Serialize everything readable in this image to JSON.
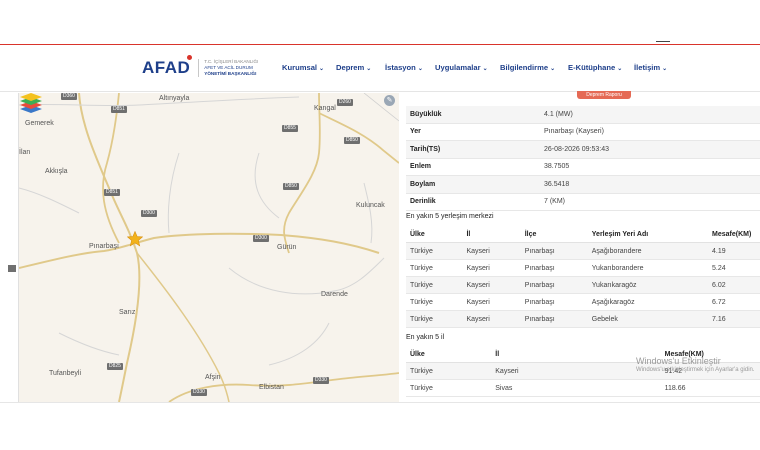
{
  "header": {
    "logo_text": "AFAD",
    "logo_sub": [
      "T.C. İÇİŞLERİ BAKANLIĞI",
      "AFET VE ACİL DURUM",
      "YÖNETİMİ BAŞKANLIĞI"
    ],
    "nav": [
      {
        "label": "Kurumsal"
      },
      {
        "label": "Deprem"
      },
      {
        "label": "İstasyon"
      },
      {
        "label": "Uygulamalar"
      },
      {
        "label": "Bilgilendirme"
      },
      {
        "label": "E-Kütüphane"
      },
      {
        "label": "İletişim"
      }
    ]
  },
  "map": {
    "towns": {
      "alonyayla": "Altınyayla",
      "gemerek": "Gemerek",
      "ilan": "İlan",
      "akkisla": "Akkışla",
      "kangal": "Kangal",
      "kuluncak": "Kuluncak",
      "pinarbasi": "Pınarbaşı",
      "gurun": "Gürün",
      "darende": "Darende",
      "sariz": "Sarız",
      "tufanbeyli": "Tufanbeyli",
      "afsin": "Afşin",
      "elbistan": "Elbistan"
    },
    "roads": [
      "D360",
      "D851",
      "D260",
      "D855",
      "D850",
      "D851",
      "D850",
      "D300",
      "D300",
      "D825",
      "D330",
      "D330"
    ],
    "epicenter_icon": "star-icon",
    "layers_icon": "layers-icon",
    "edit_icon": "pencil-icon"
  },
  "panel": {
    "report_button": "Deprem Raporu",
    "details": [
      {
        "key": "Büyüklük",
        "value": "4.1 (MW)"
      },
      {
        "key": "Yer",
        "value": "Pınarbaşı (Kayseri)"
      },
      {
        "key": "Tarih(TS)",
        "value": "26-08-2026 09:53:43"
      },
      {
        "key": "Enlem",
        "value": "38.7505"
      },
      {
        "key": "Boylam",
        "value": "36.5418"
      },
      {
        "key": "Derinlik",
        "value": "7 (KM)"
      }
    ],
    "nearest_settlements_title": "En yakın 5 yerleşim merkezi",
    "settlement_headers": [
      "Ülke",
      "İl",
      "İlçe",
      "Yerleşim Yeri Adı",
      "Mesafe(KM)"
    ],
    "settlements": [
      [
        "Türkiye",
        "Kayseri",
        "Pınarbaşı",
        "Aşağıborandere",
        "4.19"
      ],
      [
        "Türkiye",
        "Kayseri",
        "Pınarbaşı",
        "Yukarıborandere",
        "5.24"
      ],
      [
        "Türkiye",
        "Kayseri",
        "Pınarbaşı",
        "Yukarıkaragöz",
        "6.02"
      ],
      [
        "Türkiye",
        "Kayseri",
        "Pınarbaşı",
        "Aşağıkaragöz",
        "6.72"
      ],
      [
        "Türkiye",
        "Kayseri",
        "Pınarbaşı",
        "Gebelek",
        "7.16"
      ]
    ],
    "nearest_provinces_title": "En yakın 5 il",
    "province_headers": [
      "Ülke",
      "İl",
      "Mesafe(KM)"
    ],
    "provinces": [
      [
        "Türkiye",
        "Kayseri",
        "91.42"
      ],
      [
        "Türkiye",
        "Sivas",
        "118.66"
      ]
    ]
  },
  "watermark": {
    "line1": "Windows'u Etkinleştir",
    "line2": "Windows'u etkinleştirmek için Ayarlar'a gidin."
  }
}
